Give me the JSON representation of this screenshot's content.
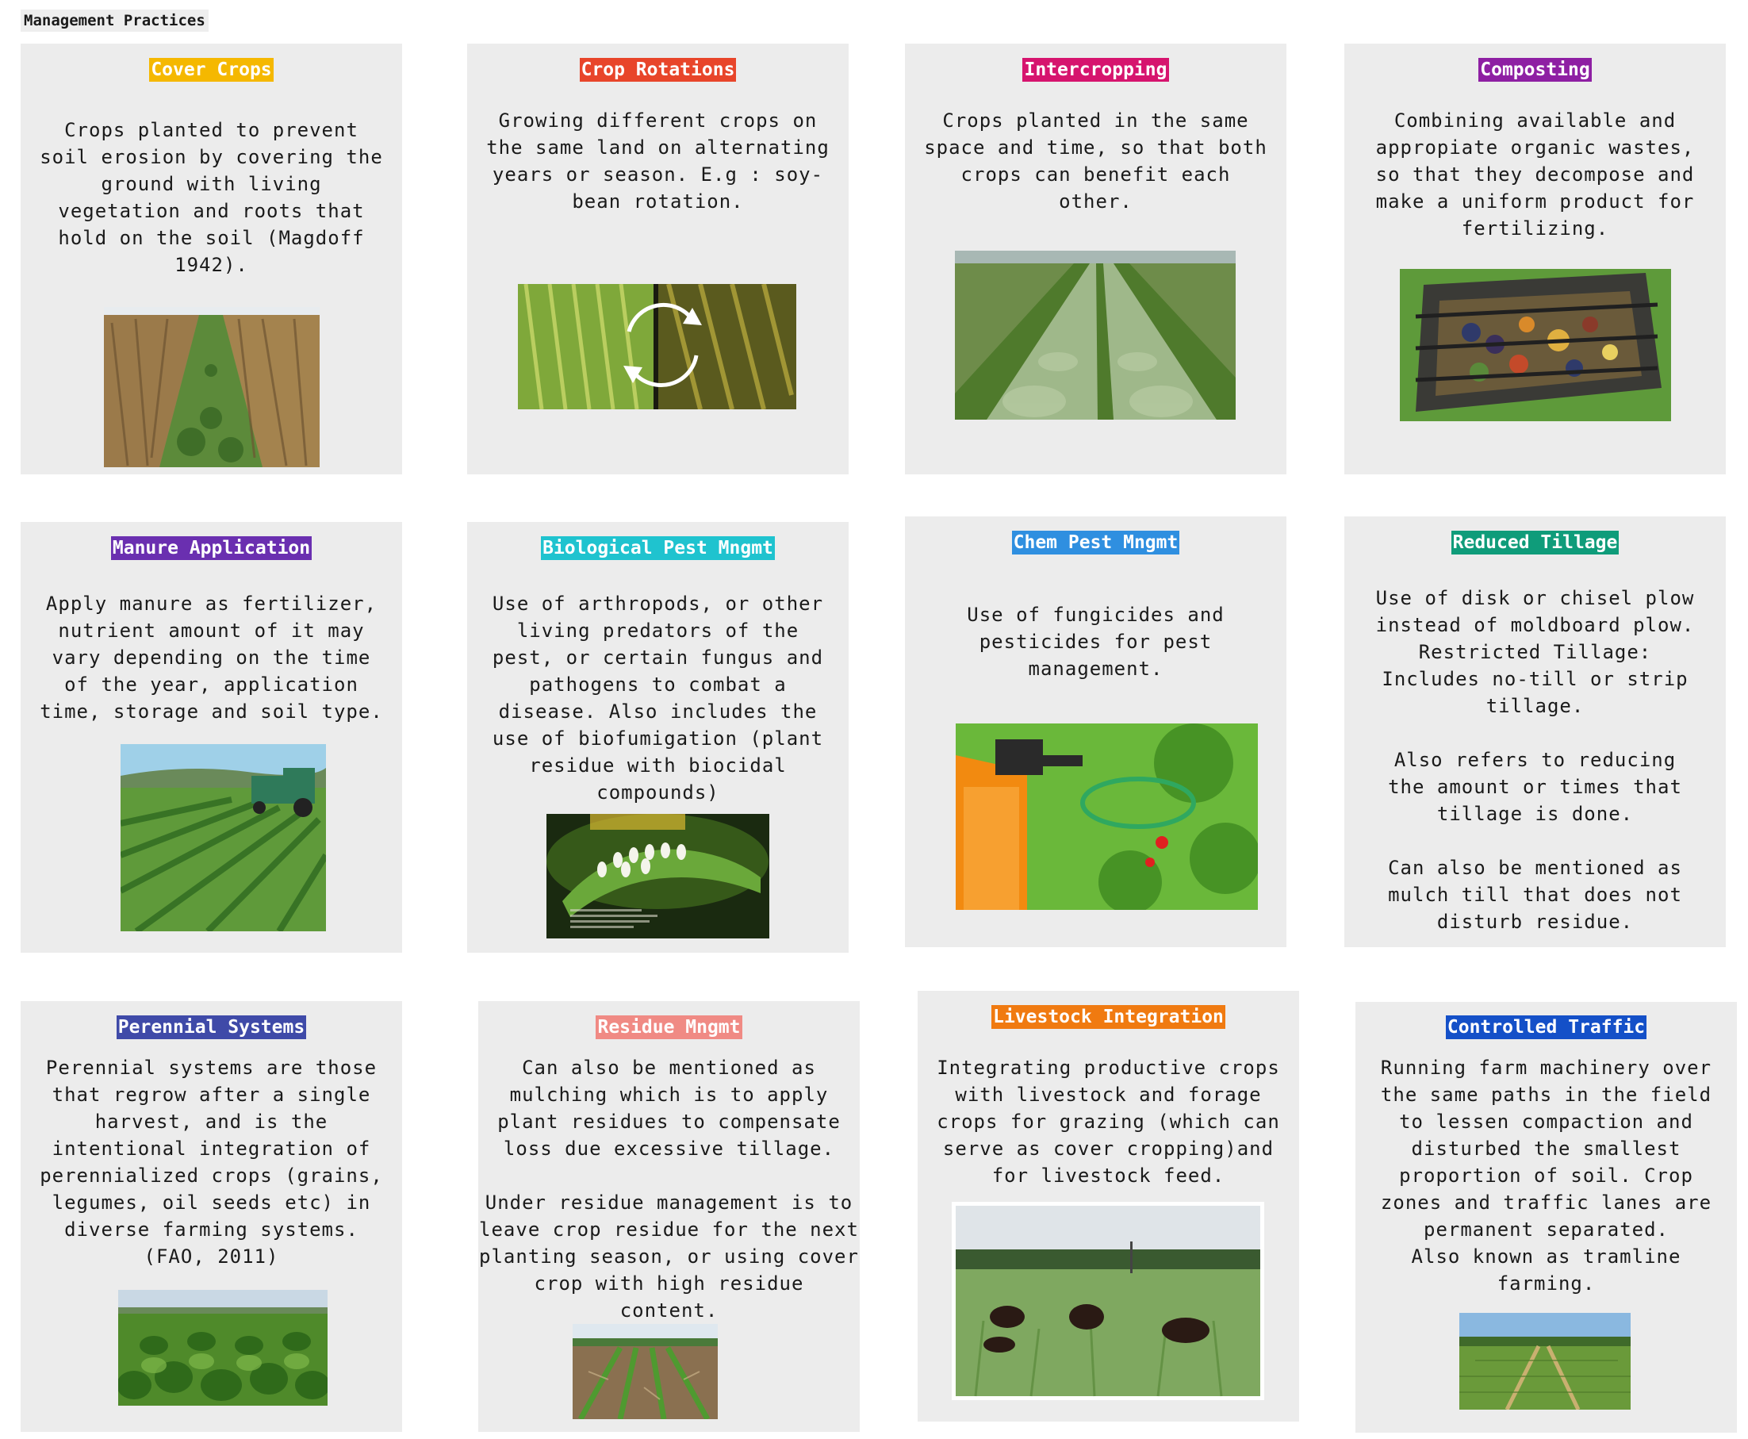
{
  "page": {
    "title": "Management Practices"
  },
  "cards": [
    {
      "title": "Cover Crops",
      "color": "#f5b800",
      "description": "Crops planted to prevent\nsoil erosion by covering the\nground with living\nvegetation and roots that\nhold on the soil (Magdoff\n1942).",
      "image": "corn-field-with-cover-crop-photo"
    },
    {
      "title": "Crop Rotations",
      "color": "#e8452a",
      "description": "Growing different crops on\nthe same land on alternating\nyears or season. E.g : soy-\nbean rotation.",
      "image": "corn-soybean-rotation-photo"
    },
    {
      "title": "Intercropping",
      "color": "#d6146e",
      "description": "Crops planted in the same\nspace and time, so that both\ncrops can benefit each\nother.",
      "image": "intercropped-rows-photo"
    },
    {
      "title": "Composting",
      "color": "#8e1fa3",
      "description": "Combining available and\nappropiate organic wastes,\nso that they decompose and\nmake a uniform product for\nfertilizing.",
      "image": "compost-bin-photo"
    },
    {
      "title": "Manure Application",
      "color": "#6a2fb0",
      "description": "Apply manure as fertilizer,\nnutrient amount of it may\nvary depending on the time\nof the year, application\ntime, storage and soil type.",
      "image": "manure-spreader-photo"
    },
    {
      "title": "Biological Pest Mngmt",
      "color": "#1fc3cf",
      "description": "Use of arthropods, or other\nliving predators of the\npest, or certain fungus and\npathogens to combat a\ndisease. Also includes the\nuse of biofumigation (plant\nresidue with biocidal\ncompounds)",
      "image": "parasitized-caterpillar-photo"
    },
    {
      "title": "Chem Pest Mngmt",
      "color": "#2f8fe0",
      "description": "Use of fungicides and\npesticides for pest\nmanagement.",
      "image": "pesticide-sprayer-photo"
    },
    {
      "title": "Reduced Tillage",
      "color": "#0f9c7a",
      "description": "Use of disk or chisel plow\ninstead of moldboard plow.\nRestricted Tillage:\nIncludes no-till or strip\ntillage.\n\nAlso refers to reducing\nthe amount or times that\ntillage is done.\n\nCan also be mentioned as\nmulch till that does not\ndisturb residue.",
      "image": ""
    },
    {
      "title": "Perennial Systems",
      "color": "#3f4aa8",
      "description": "Perennial systems are those\nthat regrow after a single\nharvest, and is the\nintentional integration of\nperennialized crops (grains,\nlegumes, oil seeds etc) in\ndiverse farming systems.\n(FAO, 2011)",
      "image": "perennial-grass-field-photo"
    },
    {
      "title": "Residue Mngmt",
      "color": "#f08a84",
      "description": "Can also be mentioned as\nmulching which is to apply\nplant residues to compensate\nloss due excessive tillage.\n\nUnder residue management is to\nleave crop residue for the next\nplanting season, or using cover\ncrop with  high residue\ncontent.",
      "image": "crop-residue-rows-photo"
    },
    {
      "title": "Livestock Integration",
      "color": "#f07a10",
      "description": "Integrating productive crops\nwith livestock and forage\ncrops for grazing (which can\nserve as cover cropping)and\nfor livestock feed.",
      "image": "cattle-grazing-photo"
    },
    {
      "title": "Controlled Traffic",
      "color": "#1450c8",
      "description": "Running farm machinery over\nthe same paths in the field\nto lessen compaction and\ndisturbed the smallest\nproportion of soil. Crop\nzones and traffic lanes are\npermanent separated.\nAlso known as tramline\nfarming.",
      "image": "tramline-field-photo"
    }
  ]
}
